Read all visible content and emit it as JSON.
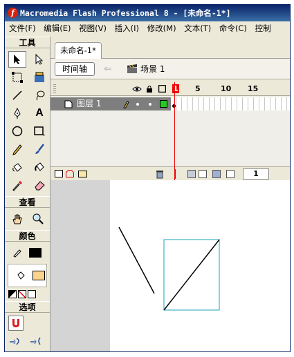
{
  "window": {
    "title": "Macromedia Flash Professional 8 - [未命名-1*]",
    "app_icon": "f"
  },
  "menubar": {
    "items": [
      "文件(F)",
      "编辑(E)",
      "视图(V)",
      "插入(I)",
      "修改(M)",
      "文本(T)",
      "命令(C)",
      "控制"
    ]
  },
  "tools": {
    "title": "工具",
    "view_title": "查看",
    "color_title": "颜色",
    "options_title": "选项",
    "items": [
      "arrow",
      "subselect",
      "free-transform",
      "fill-transform",
      "line",
      "lasso",
      "pen",
      "text",
      "oval",
      "rectangle",
      "pencil",
      "brush",
      "ink-bottle",
      "paint-bucket",
      "eyedropper",
      "eraser"
    ],
    "text_tool_glyph": "A",
    "stroke_color": "#000000",
    "fill_color": "#fbd38a"
  },
  "document": {
    "tab_label": "未命名-1*",
    "timeline_button": "时间轴",
    "scene_label": "场景 1",
    "layer_name": "图层 1",
    "ruler_labels": [
      "1",
      "5",
      "10",
      "15"
    ],
    "current_frame": "1",
    "accent_color": "#1ba3b8"
  }
}
